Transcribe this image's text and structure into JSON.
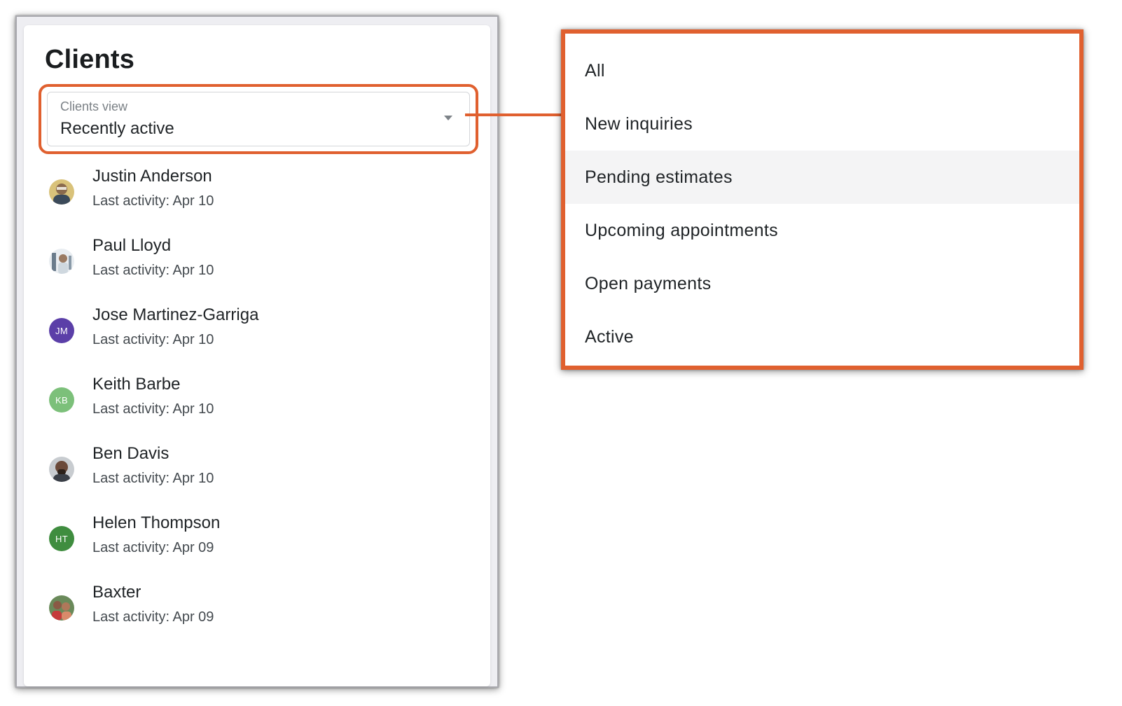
{
  "page": {
    "title": "Clients"
  },
  "clients_view": {
    "label": "Clients view",
    "selected": "Recently active"
  },
  "clients": [
    {
      "name": "Justin Anderson",
      "activity": "Last activity: Apr 10",
      "initials": "",
      "avatar_color": "#c9a46a",
      "avatar_type": "photo"
    },
    {
      "name": "Paul Lloyd",
      "activity": "Last activity: Apr 10",
      "initials": "",
      "avatar_color": "#b7c3cf",
      "avatar_type": "photo"
    },
    {
      "name": "Jose Martinez-Garriga",
      "activity": "Last activity: Apr 10",
      "initials": "JM",
      "avatar_color": "#5b3fa8",
      "avatar_type": "initials"
    },
    {
      "name": "Keith Barbe",
      "activity": "Last activity: Apr 10",
      "initials": "KB",
      "avatar_color": "#7cc07a",
      "avatar_type": "initials"
    },
    {
      "name": "Ben Davis",
      "activity": "Last activity: Apr 10",
      "initials": "",
      "avatar_color": "#6b4a3a",
      "avatar_type": "photo"
    },
    {
      "name": "Helen Thompson",
      "activity": "Last activity: Apr 09",
      "initials": "HT",
      "avatar_color": "#3f8d3f",
      "avatar_type": "initials"
    },
    {
      "name": "Baxter",
      "activity": "Last activity: Apr 09",
      "initials": "",
      "avatar_color": "#b8664a",
      "avatar_type": "photo"
    }
  ],
  "dropdown": {
    "options": [
      "All",
      "New inquiries",
      "Pending estimates",
      "Upcoming appointments",
      "Open payments",
      "Active"
    ],
    "hovered": "Pending estimates"
  },
  "colors": {
    "highlight": "#e0602f",
    "hover_bg": "#f4f4f5"
  },
  "icons": {
    "select_caret": "caret-down-icon"
  }
}
